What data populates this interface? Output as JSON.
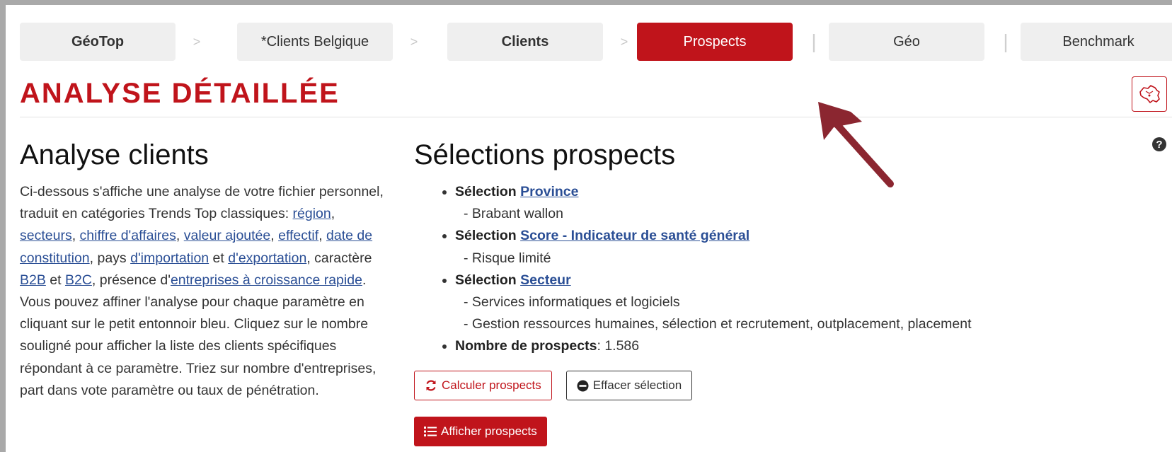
{
  "nav": {
    "tabs": [
      {
        "label": "GéoTop"
      },
      {
        "label": "*Clients Belgique"
      },
      {
        "label": "Clients"
      },
      {
        "label": "Prospects"
      },
      {
        "label": "Géo"
      },
      {
        "label": "Benchmark"
      }
    ],
    "sep_arrow": ">",
    "sep_bar": "|"
  },
  "page_title": "ANALYSE DÉTAILLÉE",
  "help_glyph": "?",
  "left": {
    "heading": "Analyse clients",
    "t1": "Ci-dessous s'affiche une analyse de votre fichier personnel, traduit en catégories Trends Top classiques: ",
    "l_region": "région",
    "c1": ", ",
    "l_secteurs": "secteurs",
    "c2": ", ",
    "l_ca": "chiffre d'affaires",
    "c3": ", ",
    "l_va": "valeur ajoutée",
    "c4": ", ",
    "l_effectif": "effectif",
    "c5": ", ",
    "l_date": "date de constitution",
    "t2": ", pays ",
    "l_import": "d'importation",
    "t3": " et ",
    "l_export": "d'exportation",
    "t4": ", caractère ",
    "l_b2b": "B2B",
    "t5": " et ",
    "l_b2c": "B2C",
    "t6": ", présence d'",
    "l_croissance": "entreprises à croissance rapide",
    "t7": ".",
    "t8": "Vous pouvez affiner l'analyse pour chaque paramètre en cliquant sur le petit entonnoir bleu. Cliquez sur le nombre souligné pour afficher la liste des clients spécifiques répondant à ce paramètre. Triez sur nombre d'entreprises, part dans vote paramètre ou taux de pénétration."
  },
  "mid": {
    "heading": "Sélections prospects",
    "sel_prefix": "Sélection ",
    "sel1_link": "Province",
    "sel1_val": "- Brabant wallon",
    "sel2_link": "Score - Indicateur de santé général",
    "sel2_val": "- Risque limité",
    "sel3_link": "Secteur",
    "sel3_val1": "- Services informatiques et logiciels",
    "sel3_val2": "- Gestion ressources humaines, sélection et recrutement, outplacement, placement",
    "count_label": "Nombre de prospects",
    "count_sep": ": ",
    "count_value": "1.586"
  },
  "buttons": {
    "calc": "Calculer prospects",
    "clear": "Effacer sélection",
    "show": "Afficher prospects"
  },
  "colors": {
    "accent": "#c0141b",
    "link": "#2a4e95",
    "annotation_arrow": "#8b2630"
  },
  "icons": {
    "map": "belgium-map-icon",
    "refresh": "refresh-icon",
    "minus_circle": "minus-circle-icon",
    "list": "list-icon",
    "help": "question-circle-icon"
  }
}
